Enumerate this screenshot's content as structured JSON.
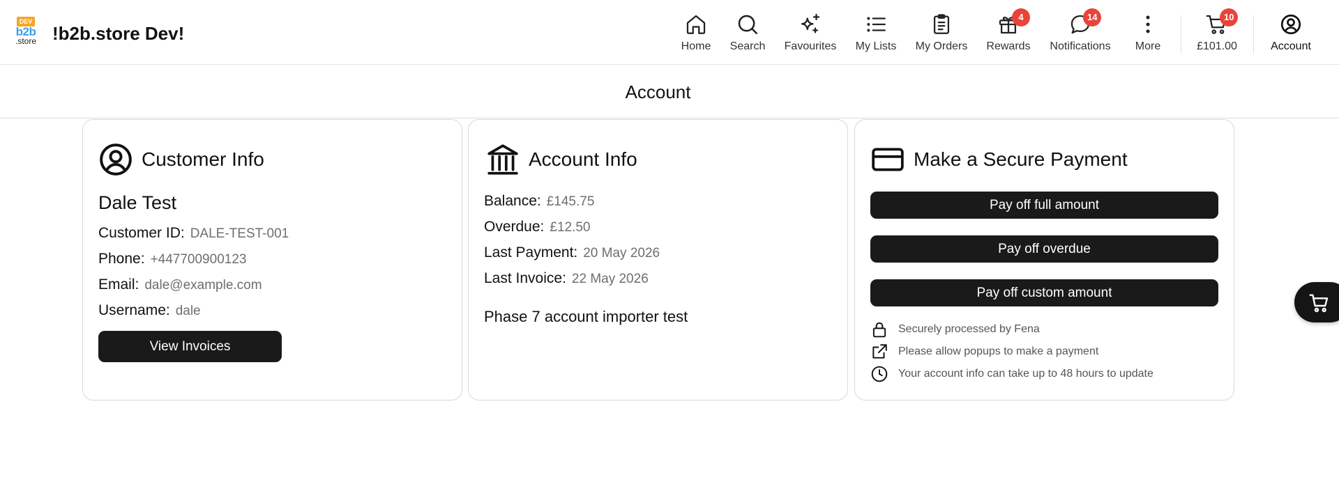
{
  "header": {
    "logo_badge": "DEV",
    "logo_top": "b2b",
    "logo_bottom": ".store",
    "brand": "!b2b.store Dev!",
    "nav": [
      {
        "label": "Home",
        "icon": "home-icon"
      },
      {
        "label": "Search",
        "icon": "search-icon"
      },
      {
        "label": "Favourites",
        "icon": "sparkle-icon"
      },
      {
        "label": "My Lists",
        "icon": "list-icon"
      },
      {
        "label": "My Orders",
        "icon": "clipboard-icon"
      },
      {
        "label": "Rewards",
        "icon": "gift-icon",
        "badge": "4"
      },
      {
        "label": "Notifications",
        "icon": "chat-bubble-icon",
        "badge": "14"
      },
      {
        "label": "More",
        "icon": "more-vertical-icon"
      },
      {
        "label": "£101.00",
        "icon": "cart-icon",
        "badge": "10"
      },
      {
        "label": "Account",
        "icon": "user-circle-icon"
      }
    ]
  },
  "page": {
    "title": "Account"
  },
  "customer_info": {
    "title": "Customer Info",
    "name": "Dale Test",
    "fields": [
      {
        "key": "Customer ID:",
        "value": "DALE-TEST-001"
      },
      {
        "key": "Phone:",
        "value": "+447700900123"
      },
      {
        "key": "Email:",
        "value": "dale@example.com"
      },
      {
        "key": "Username:",
        "value": "dale"
      }
    ],
    "button": "View Invoices"
  },
  "account_info": {
    "title": "Account Info",
    "fields": [
      {
        "key": "Balance:",
        "value": "£145.75"
      },
      {
        "key": "Overdue:",
        "value": "£12.50"
      },
      {
        "key": "Last Payment:",
        "value": "20 May 2026"
      },
      {
        "key": "Last Invoice:",
        "value": "22 May 2026"
      }
    ],
    "note": "Phase 7 account importer test"
  },
  "payment": {
    "title": "Make a Secure Payment",
    "buttons": [
      "Pay off full amount",
      "Pay off overdue",
      "Pay off custom amount"
    ],
    "notes": [
      {
        "icon": "lock-icon",
        "text": "Securely processed by Fena"
      },
      {
        "icon": "external-link-icon",
        "text": "Please allow popups to make a payment"
      },
      {
        "icon": "clock-icon",
        "text": "Your account info can take up to 48 hours to update"
      }
    ]
  },
  "colors": {
    "badge": "#e9443a",
    "button": "#1a1a1a",
    "logo_blue": "#3aa0e8",
    "logo_orange": "#f5a623"
  }
}
